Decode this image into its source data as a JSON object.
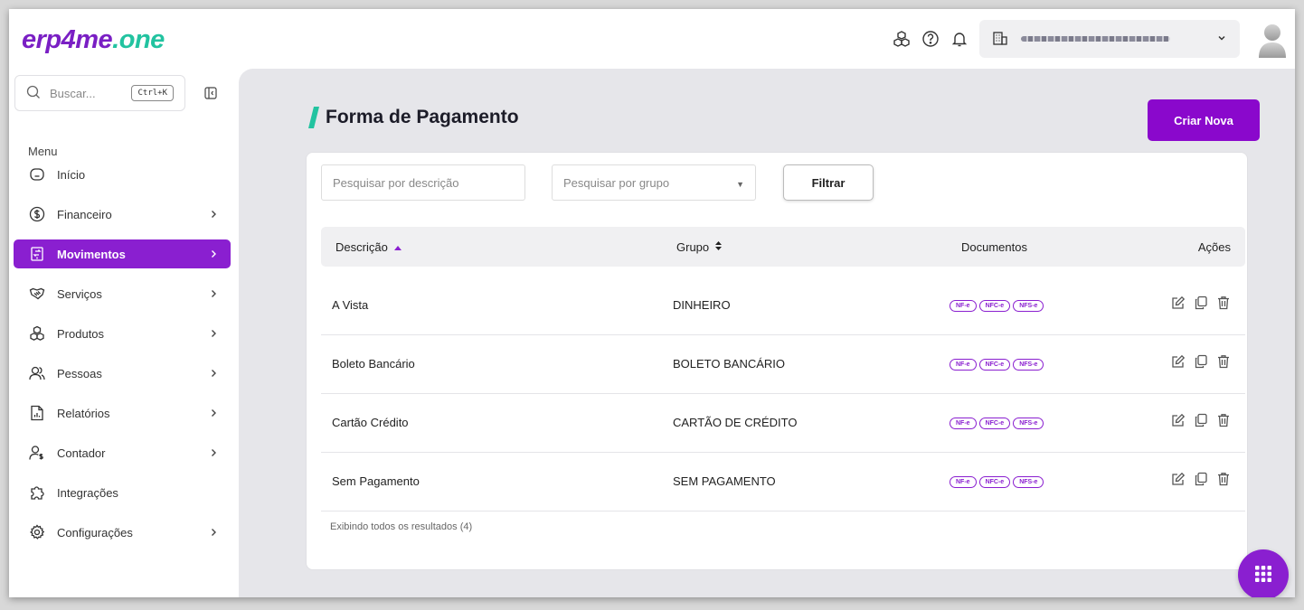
{
  "app": {
    "logo_part1": "erp4me",
    "logo_part2": ".one",
    "accent_color": "#8a1fd0",
    "brand_green": "#22c3a0"
  },
  "header": {
    "icons": [
      "modules-icon",
      "help-icon",
      "bell-icon"
    ],
    "company_selector_icon": "building-icon"
  },
  "sidebar": {
    "search_placeholder": "Buscar...",
    "search_shortcut": "Ctrl+K",
    "menu_title": "Menu",
    "items": [
      {
        "label": "Início",
        "icon": "home-icon",
        "has_chevron": false,
        "active": false
      },
      {
        "label": "Financeiro",
        "icon": "dollar-icon",
        "has_chevron": true,
        "active": false
      },
      {
        "label": "Movimentos",
        "icon": "exchange-icon",
        "has_chevron": true,
        "active": true
      },
      {
        "label": "Serviços",
        "icon": "handshake-icon",
        "has_chevron": true,
        "active": false
      },
      {
        "label": "Produtos",
        "icon": "boxes-icon",
        "has_chevron": true,
        "active": false
      },
      {
        "label": "Pessoas",
        "icon": "users-icon",
        "has_chevron": true,
        "active": false
      },
      {
        "label": "Relatórios",
        "icon": "report-icon",
        "has_chevron": true,
        "active": false
      },
      {
        "label": "Contador",
        "icon": "accountant-icon",
        "has_chevron": true,
        "active": false
      },
      {
        "label": "Integrações",
        "icon": "puzzle-icon",
        "has_chevron": false,
        "active": false
      },
      {
        "label": "Configurações",
        "icon": "gear-icon",
        "has_chevron": true,
        "active": false
      }
    ]
  },
  "main": {
    "title": "Forma de Pagamento",
    "create_button": "Criar Nova",
    "filters": {
      "description_placeholder": "Pesquisar por descrição",
      "group_placeholder": "Pesquisar por grupo",
      "filter_button": "Filtrar"
    },
    "table": {
      "columns": {
        "description": "Descrição",
        "group": "Grupo",
        "documents": "Documentos",
        "actions": "Ações"
      },
      "rows": [
        {
          "description": "A Vista",
          "group": "DINHEIRO",
          "docs": [
            "NF-e",
            "NFC-e",
            "NFS-e"
          ]
        },
        {
          "description": "Boleto Bancário",
          "group": "BOLETO BANCÁRIO",
          "docs": [
            "NF-e",
            "NFC-e",
            "NFS-e"
          ]
        },
        {
          "description": "Cartão Crédito",
          "group": "CARTÃO DE CRÉDITO",
          "docs": [
            "NF-e",
            "NFC-e",
            "NFS-e"
          ]
        },
        {
          "description": "Sem Pagamento",
          "group": "SEM PAGAMENTO",
          "docs": [
            "NF-e",
            "NFC-e",
            "NFS-e"
          ]
        }
      ]
    },
    "results_text": "Exibindo todos os resultados (4)"
  }
}
